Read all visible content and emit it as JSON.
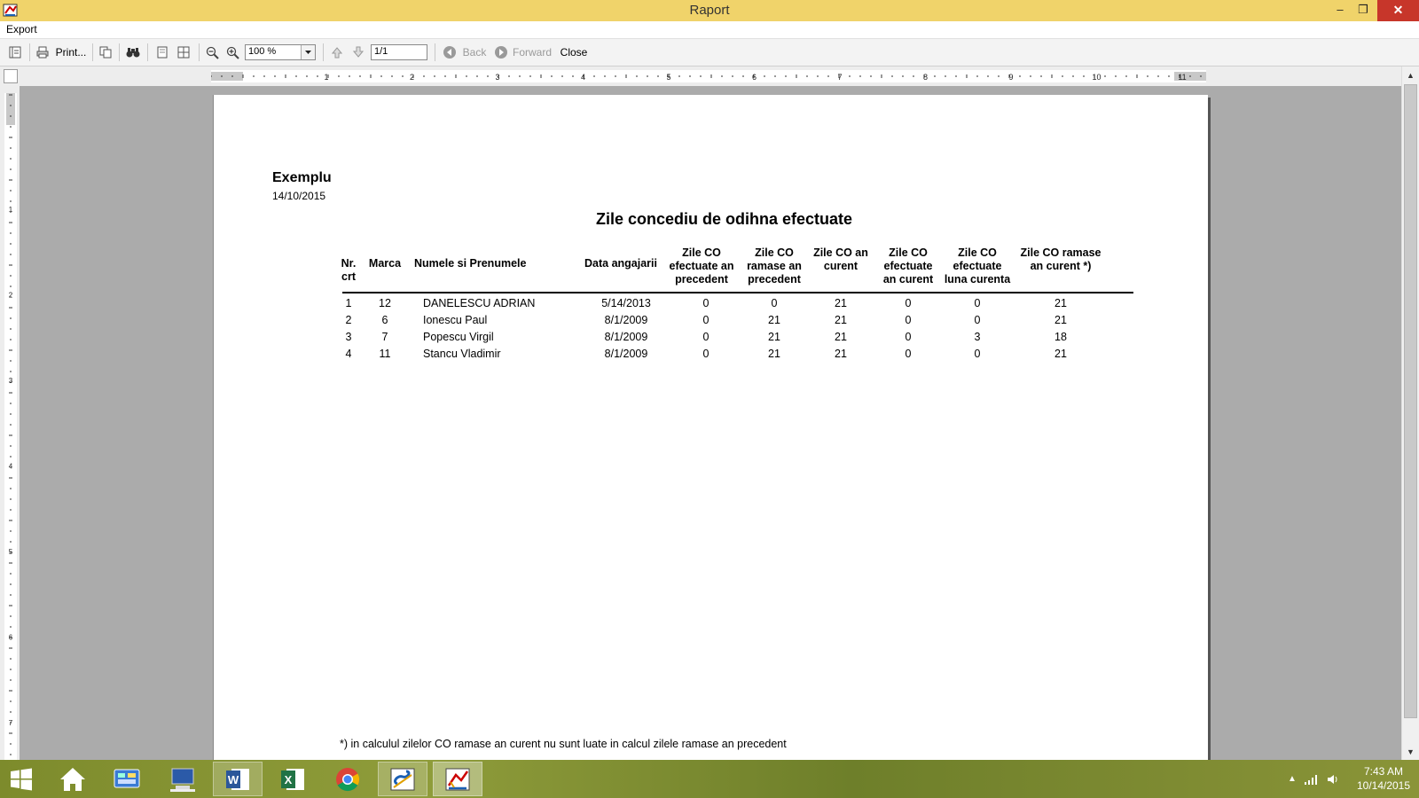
{
  "window": {
    "title": "Raport",
    "min_glyph": "–",
    "max_glyph": "❐",
    "close_glyph": "✕"
  },
  "menu": {
    "export": "Export"
  },
  "toolbar": {
    "print_label": "Print...",
    "zoom_value": "100 %",
    "page_value": "1/1",
    "back_label": "Back",
    "forward_label": "Forward",
    "close_label": "Close"
  },
  "ruler": {
    "h_numbers": [
      "1",
      "2",
      "3",
      "4",
      "5",
      "6",
      "7",
      "8",
      "9",
      "10",
      "11"
    ],
    "v_numbers": [
      "1",
      "2",
      "3",
      "4",
      "5",
      "6",
      "7"
    ]
  },
  "report": {
    "company": "Exemplu",
    "date": "14/10/2015",
    "title": "Zile concediu de odihna efectuate",
    "headers": {
      "nr": [
        "Nr.",
        "crt"
      ],
      "marca": [
        "Marca"
      ],
      "nume": [
        "Numele si Prenumele"
      ],
      "data": [
        "Data angajarii"
      ],
      "efect_prec": [
        "Zile CO",
        "efectuate an",
        "precedent"
      ],
      "ramase_prec": [
        "Zile CO",
        "ramase an",
        "precedent"
      ],
      "an_curent": [
        "Zile CO an",
        "curent"
      ],
      "efect_curent": [
        "Zile CO",
        "efectuate",
        "an curent"
      ],
      "efect_luna": [
        "Zile CO",
        "efectuate",
        "luna curenta"
      ],
      "ramase_curent": [
        "Zile CO ramase",
        "an curent *)"
      ]
    },
    "rows": [
      {
        "nr": "1",
        "marca": "12",
        "nume": "DANELESCU ADRIAN",
        "data": "5/14/2013",
        "efect_prec": "0",
        "ramase_prec": "0",
        "an_curent": "21",
        "efect_curent": "0",
        "efect_luna": "0",
        "ramase_curent": "21"
      },
      {
        "nr": "2",
        "marca": "6",
        "nume": "Ionescu Paul",
        "data": "8/1/2009",
        "efect_prec": "0",
        "ramase_prec": "21",
        "an_curent": "21",
        "efect_curent": "0",
        "efect_luna": "0",
        "ramase_curent": "21"
      },
      {
        "nr": "3",
        "marca": "7",
        "nume": "Popescu Virgil",
        "data": "8/1/2009",
        "efect_prec": "0",
        "ramase_prec": "21",
        "an_curent": "21",
        "efect_curent": "0",
        "efect_luna": "3",
        "ramase_curent": "18"
      },
      {
        "nr": "4",
        "marca": "11",
        "nume": "Stancu Vladimir",
        "data": "8/1/2009",
        "efect_prec": "0",
        "ramase_prec": "21",
        "an_curent": "21",
        "efect_curent": "0",
        "efect_luna": "0",
        "ramase_curent": "21"
      }
    ],
    "footnote": "*) in calculul zilelor CO ramase an curent  nu sunt luate in calcul zilele ramase an precedent"
  },
  "taskbar": {
    "apps": [
      "start-windows",
      "home-icon",
      "control-panel-icon",
      "computer-icon",
      "word-icon",
      "excel-icon",
      "chrome-icon",
      "app-s-icon",
      "app-report-icon"
    ],
    "tray_arrow": "▲",
    "clock_time": "7:43 AM",
    "clock_date": "10/14/2015"
  },
  "colors": {
    "titlebar": "#f0d36a",
    "close": "#c7362a",
    "taskbar": "#7d8b2c"
  }
}
